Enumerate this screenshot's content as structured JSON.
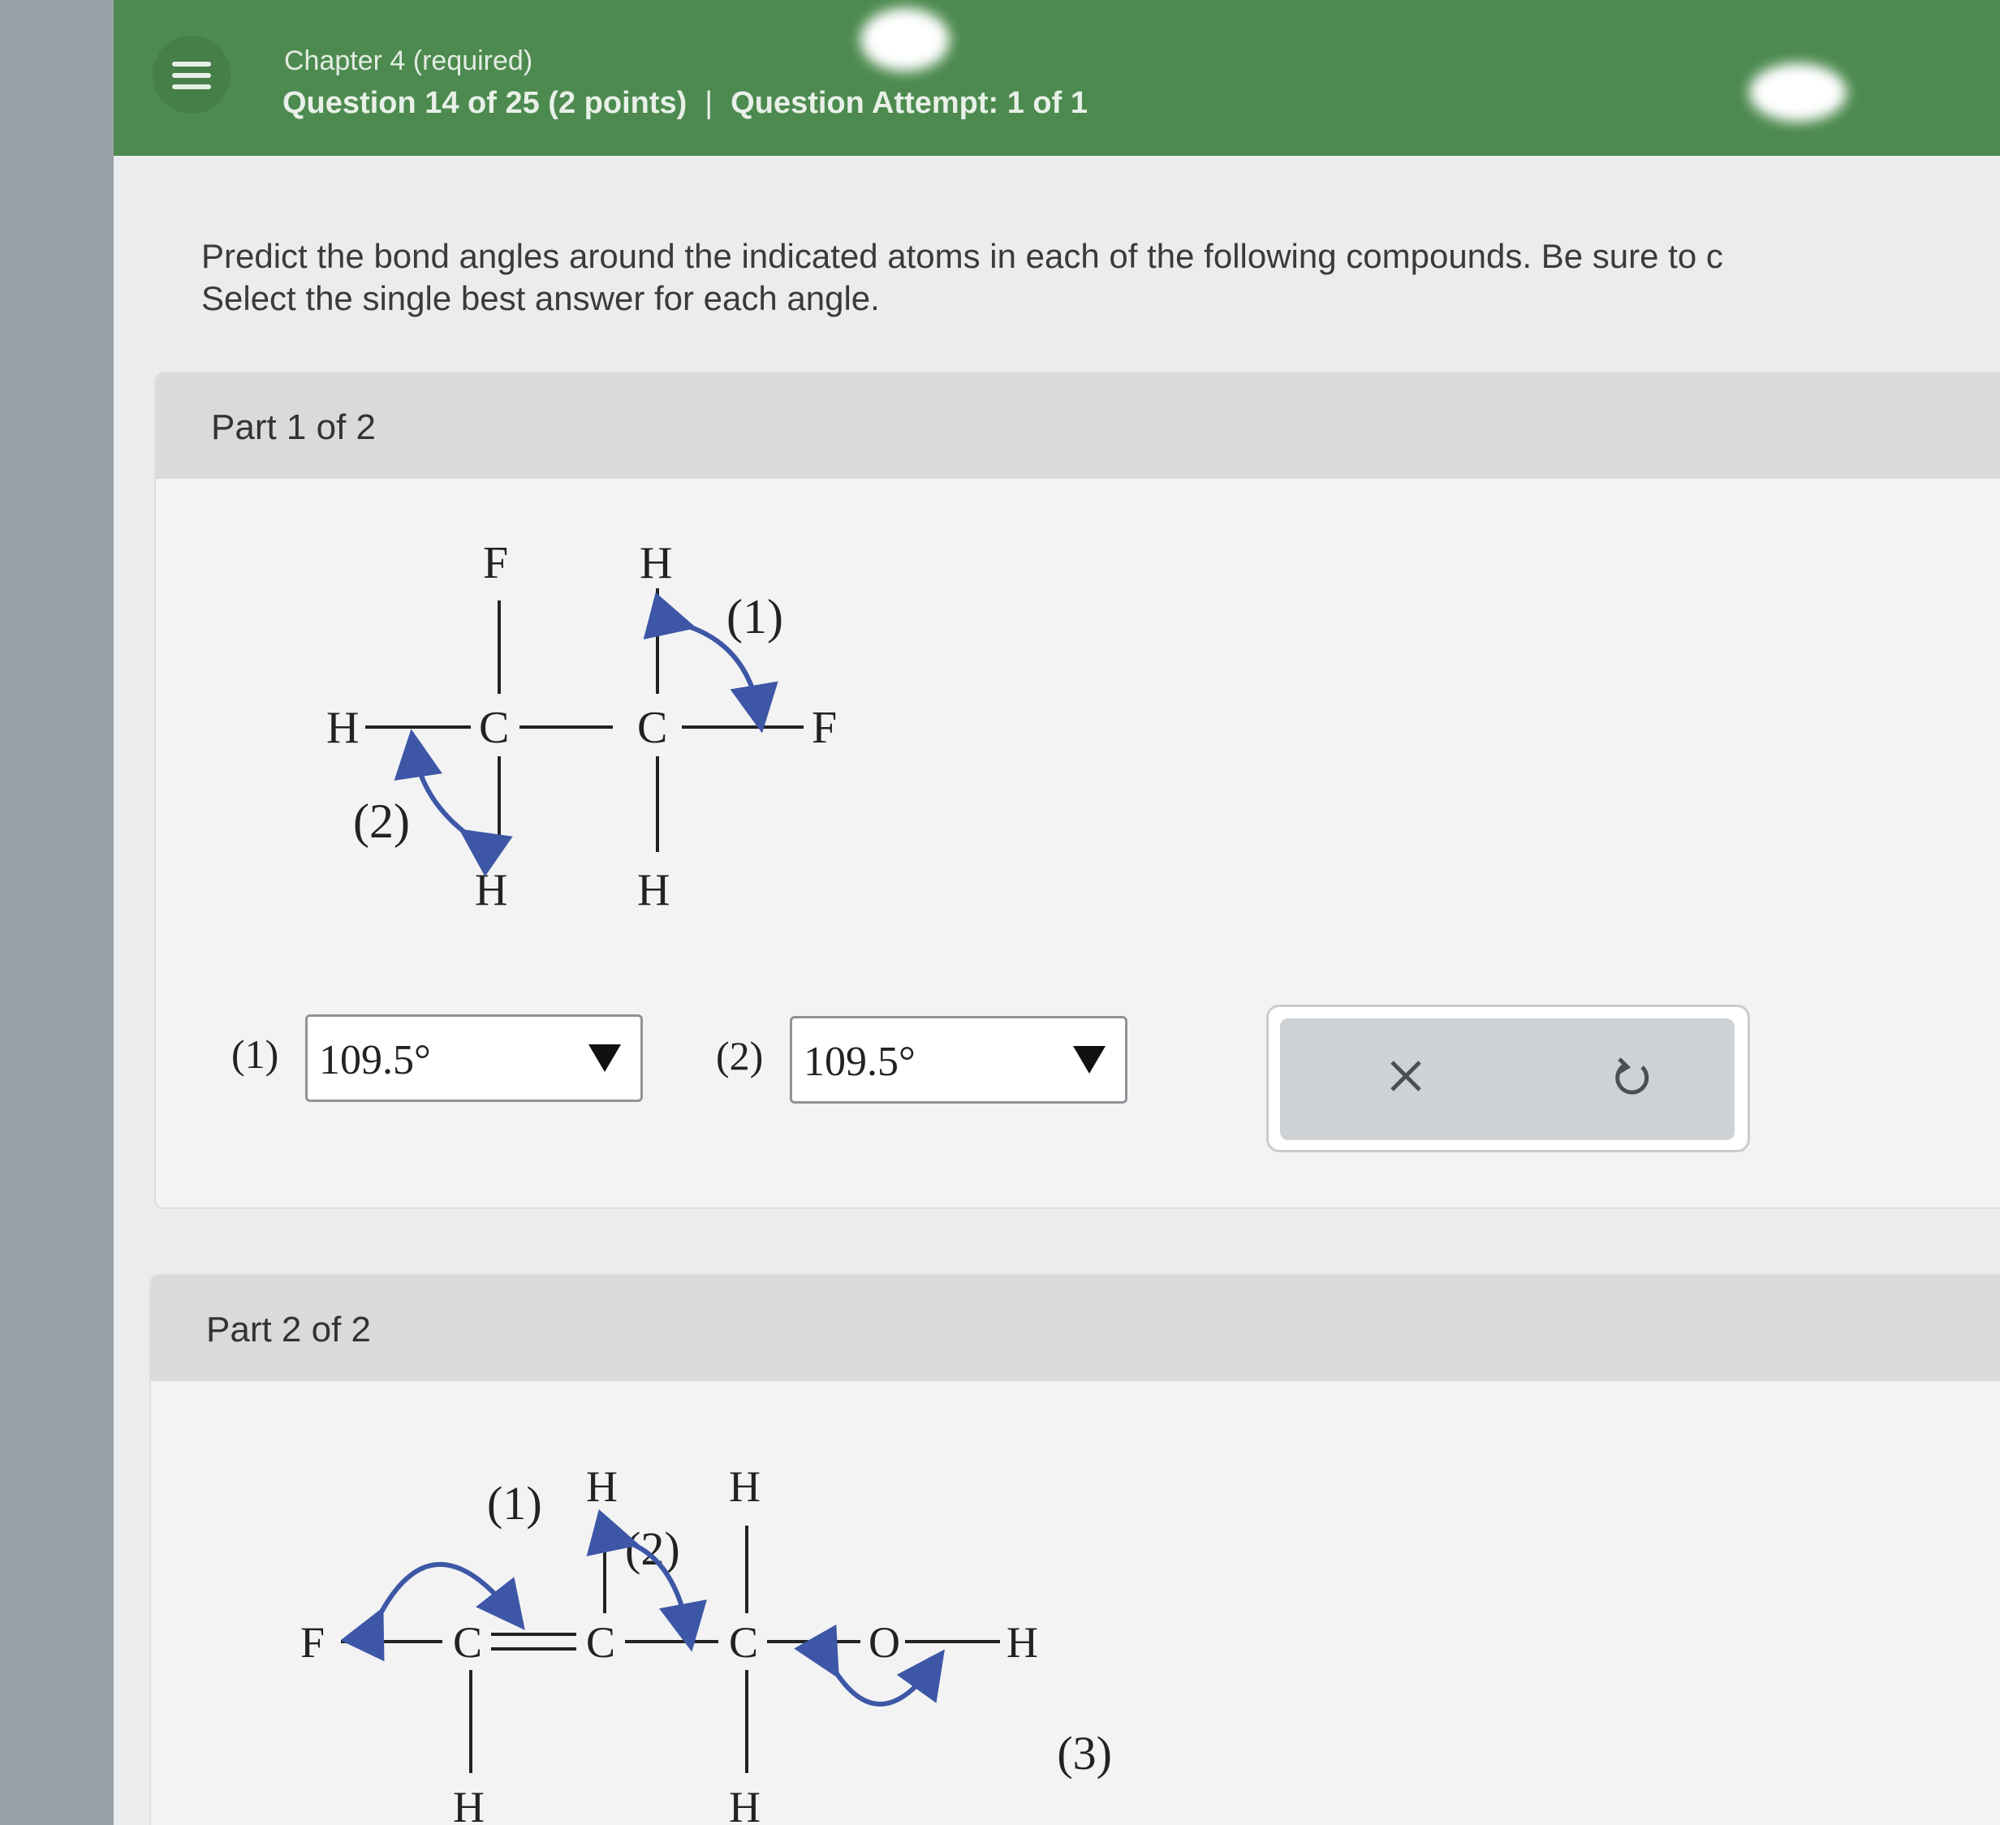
{
  "header": {
    "chapter": "Chapter 4 (required)",
    "question": "Question 14 of 25 (2 points)",
    "separator": "|",
    "attempt": "Question Attempt: 1 of 1",
    "menu_icon": "hamburger-menu-icon"
  },
  "prompt": {
    "line1": "Predict the bond angles around the indicated atoms in each of the following compounds. Be sure to c",
    "line2": "Select the single best answer for each angle."
  },
  "part1": {
    "title": "Part 1 of 2",
    "molecule": {
      "atom_F_top": "F",
      "atom_H_top": "H",
      "atom_H_left": "H",
      "atom_C1": "C",
      "atom_C2": "C",
      "atom_F_right": "F",
      "atom_H_bottom1": "H",
      "atom_H_bottom2": "H",
      "label_1": "(1)",
      "label_2": "(2)"
    },
    "answers": [
      {
        "label": "(1)",
        "value": "109.5°"
      },
      {
        "label": "(2)",
        "value": "109.5°"
      }
    ],
    "tools": {
      "clear_icon": "close-x-icon",
      "undo_icon": "undo-icon"
    },
    "colors": {
      "arrow": "#3d57a6",
      "header_green": "#4d8a4f"
    }
  },
  "part2": {
    "title": "Part 2 of 2",
    "molecule": {
      "atom_F": "F",
      "atom_C1": "C",
      "atom_C2": "C",
      "atom_C3": "C",
      "atom_O": "O",
      "atom_H_end": "H",
      "atom_H_top2": "H",
      "atom_H_top3": "H",
      "atom_H_bottom1": "H",
      "atom_H_bottom3": "H",
      "label_1": "(1)",
      "label_2": "(2)",
      "label_3": "(3)"
    }
  }
}
